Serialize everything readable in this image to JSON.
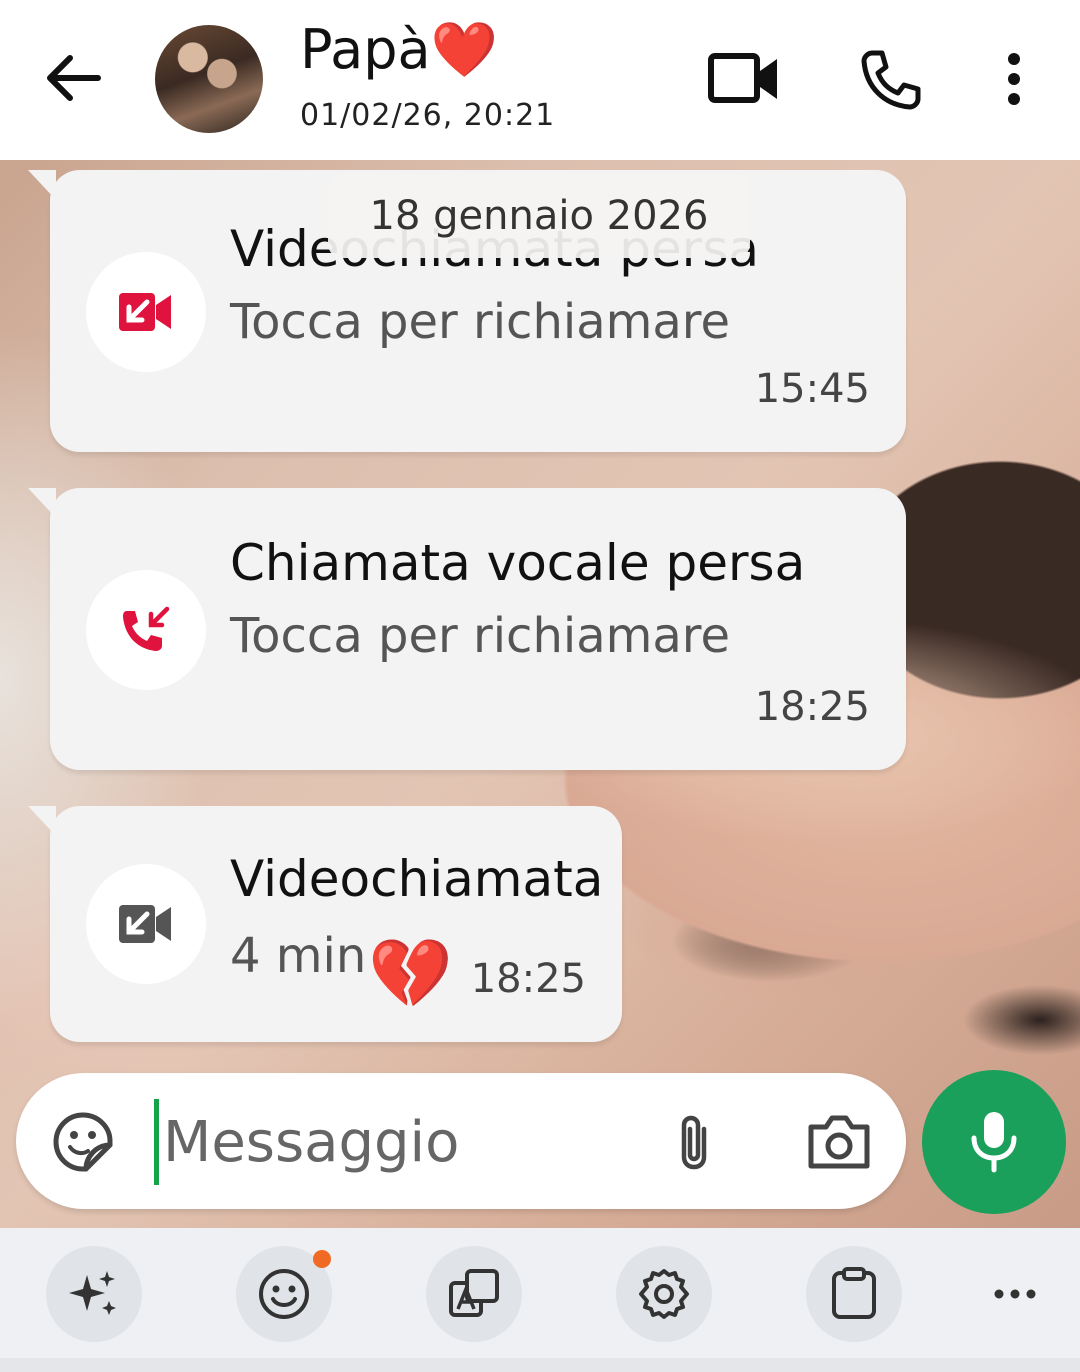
{
  "header": {
    "contact_name": "Papà",
    "name_emoji": "❤️",
    "last_seen": "01/02/26, 20:21",
    "icons": [
      "back-arrow-icon",
      "video-call-icon",
      "phone-icon",
      "more-vert-icon"
    ]
  },
  "chat": {
    "date_chip": "18 gennaio 2026",
    "messages": [
      {
        "title": "Videochiamata persa",
        "subtitle": "Tocca per richiamare",
        "time": "15:45",
        "icon": "missed-video-icon",
        "icon_color": "#e0123e"
      },
      {
        "title": "Chiamata vocale persa",
        "subtitle": "Tocca per richiamare",
        "time": "18:25",
        "icon": "missed-call-icon",
        "icon_color": "#e0123e"
      },
      {
        "title": "Videochiamata",
        "subtitle": "4 min",
        "reaction": "💔",
        "time": "18:25",
        "icon": "video-call-incoming-icon",
        "icon_color": "#555555"
      }
    ]
  },
  "composer": {
    "placeholder": "Messaggio",
    "icons": [
      "sticker-icon",
      "attach-icon",
      "camera-icon",
      "mic-icon"
    ],
    "accent": "#1aa05a"
  },
  "keyboard_toolbar": {
    "icons": [
      "ai-sparkle-icon",
      "emoji-icon",
      "translate-icon",
      "settings-icon",
      "clipboard-icon",
      "more-horiz-icon"
    ],
    "notification_color": "#f06a23"
  }
}
